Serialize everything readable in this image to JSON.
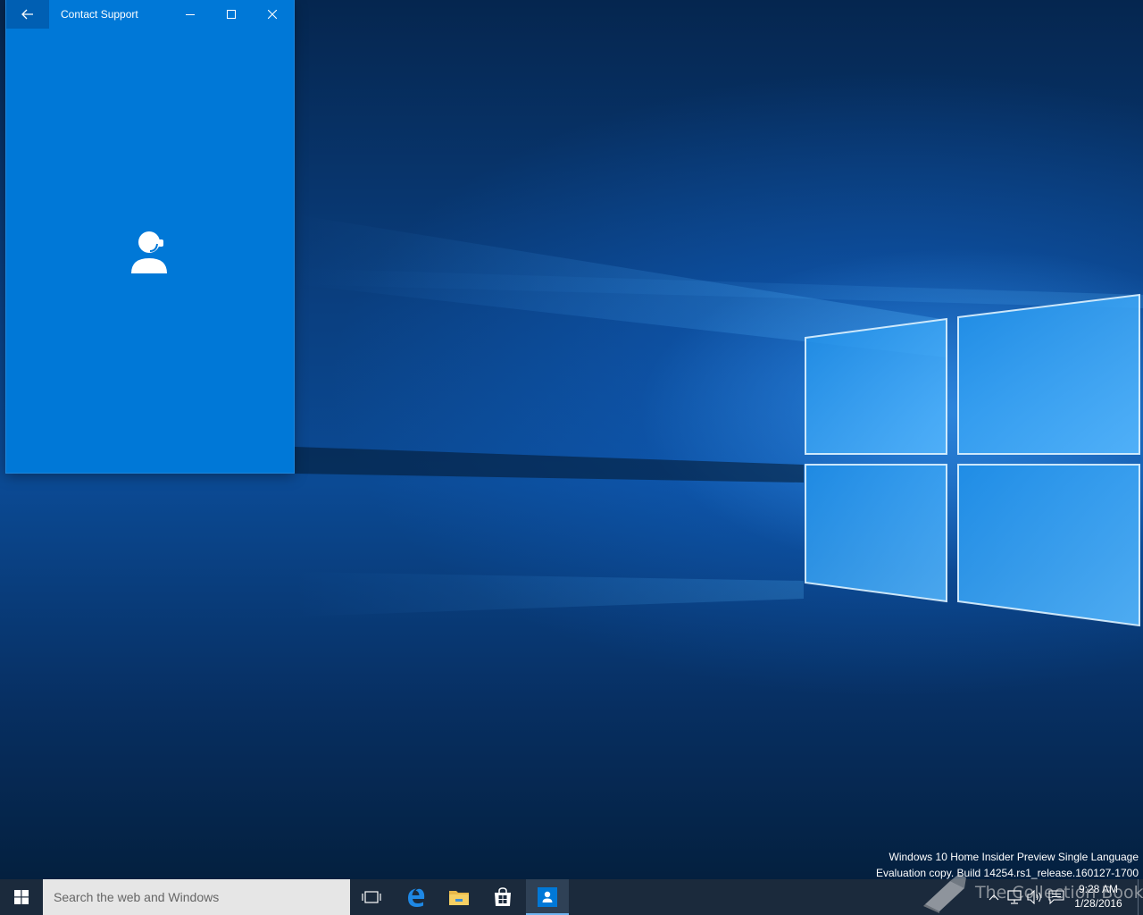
{
  "window": {
    "title": "Contact Support",
    "back_icon": "back-arrow-icon",
    "content_icon": "headset-person-icon",
    "accent_color": "#0078d7"
  },
  "watermark": {
    "line1": "Windows 10 Home Insider Preview Single Language",
    "line2": "Evaluation copy. Build 14254.rs1_release.160127-1700"
  },
  "site_watermark": {
    "text": "The Collection Book"
  },
  "taskbar": {
    "search_placeholder": "Search the web and Windows",
    "apps": [
      "task-view-icon",
      "edge-icon",
      "file-explorer-icon",
      "store-icon",
      "contact-support-icon"
    ],
    "clock_time": "9:28 AM",
    "clock_date": "1/28/2016",
    "background_color": "#1b2a3c"
  }
}
